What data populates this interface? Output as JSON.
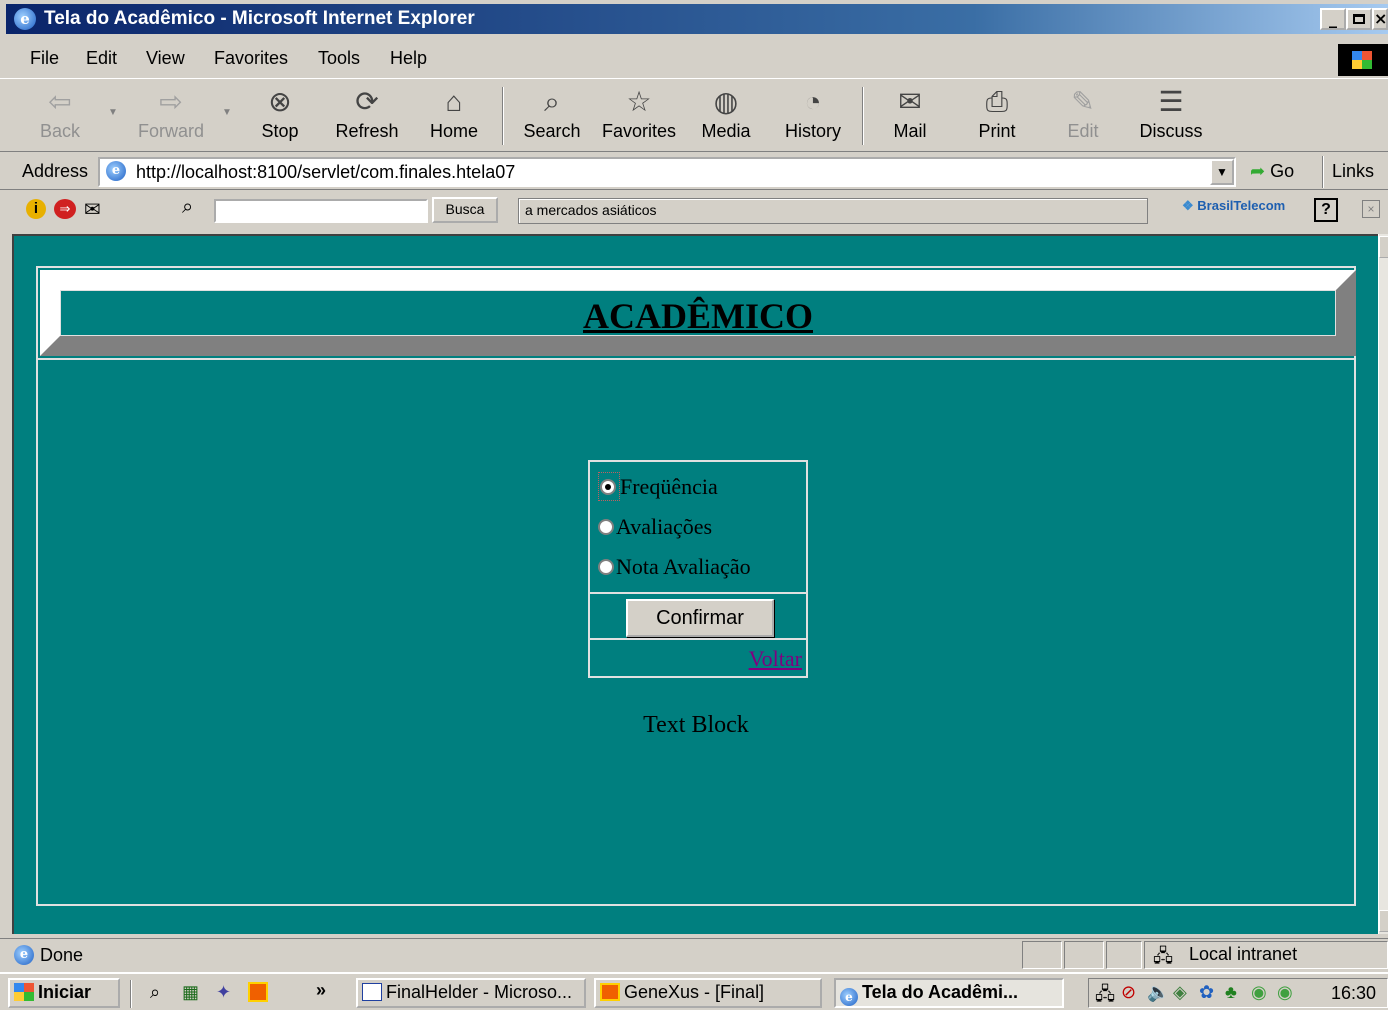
{
  "window": {
    "title": "Tela do Acadêmico - Microsoft Internet Explorer",
    "controls": [
      "_",
      " ",
      "×"
    ]
  },
  "menu": {
    "items": [
      "File",
      "Edit",
      "View",
      "Favorites",
      "Tools",
      "Help"
    ]
  },
  "toolbar": {
    "back": "Back",
    "forward": "Forward",
    "stop": "Stop",
    "refresh": "Refresh",
    "home": "Home",
    "search": "Search",
    "favorites": "Favorites",
    "media": "Media",
    "history": "History",
    "mail": "Mail",
    "print": "Print",
    "edit": "Edit",
    "discuss": "Discuss"
  },
  "address": {
    "label": "Address",
    "url": "http://localhost:8100/servlet/com.finales.htela07",
    "go": "Go",
    "links": "Links"
  },
  "custom_bar": {
    "search_value": "",
    "busca": "Busca",
    "ticker": "a mercados asiáticos",
    "brand": "BrasilTelecom",
    "help": "?"
  },
  "page": {
    "title": "ACADÊMICO",
    "options": [
      "Freqüência",
      "Avaliações",
      "Nota Avaliação"
    ],
    "selected_option": "Freqüência",
    "confirm_button": "Confirmar",
    "back_link": "Voltar",
    "text_block": "Text Block"
  },
  "status": {
    "text": "Done",
    "zone": "Local intranet"
  },
  "taskbar": {
    "start": "Iniciar",
    "chevron": "»",
    "tasks": [
      "FinalHelder - Microso...",
      "GeneXus - [Final]",
      "Tela do Acadêmi..."
    ],
    "active_task": "Tela do Acadêmi...",
    "clock": "16:30"
  },
  "colors": {
    "page_background": "#007f7f",
    "title_bar_start": "#0a246a",
    "visited_link": "#800080"
  }
}
